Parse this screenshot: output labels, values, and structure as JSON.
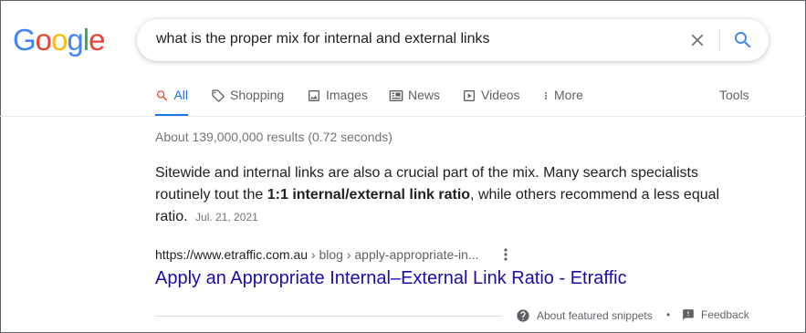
{
  "logo": {
    "letters": [
      "G",
      "o",
      "o",
      "g",
      "l",
      "e"
    ],
    "colors": [
      "#4285F4",
      "#EA4335",
      "#FBBC05",
      "#4285F4",
      "#34A853",
      "#EA4335"
    ]
  },
  "search": {
    "query": "what is the proper mix for internal and external links"
  },
  "tabs": [
    {
      "label": "All",
      "icon": "search-icon",
      "active": true
    },
    {
      "label": "Shopping",
      "icon": "tag-icon"
    },
    {
      "label": "Images",
      "icon": "image-icon"
    },
    {
      "label": "News",
      "icon": "news-icon"
    },
    {
      "label": "Videos",
      "icon": "video-icon"
    },
    {
      "label": "More",
      "icon": "more-vert-icon"
    }
  ],
  "tools_label": "Tools",
  "result_stats": "About 139,000,000 results (0.72 seconds)",
  "snippet": {
    "text_before": "Sitewide and internal links are also a crucial part of the mix. Many search specialists routinely tout the ",
    "bold": "1:1 internal/external link ratio",
    "text_after": ", while others recommend a less equal ratio.",
    "date": "Jul. 21, 2021"
  },
  "result": {
    "cite_domain": "https://www.etraffic.com.au",
    "cite_path": " › blog › apply-appropriate-in...",
    "title": "Apply an Appropriate Internal–External Link Ratio - Etraffic"
  },
  "footer": {
    "about_label": "About featured snippets",
    "separator": "•",
    "feedback_label": "Feedback"
  },
  "colors": {
    "accent": "#1a73e8",
    "link": "#1a0dab",
    "muted": "#70757a"
  }
}
